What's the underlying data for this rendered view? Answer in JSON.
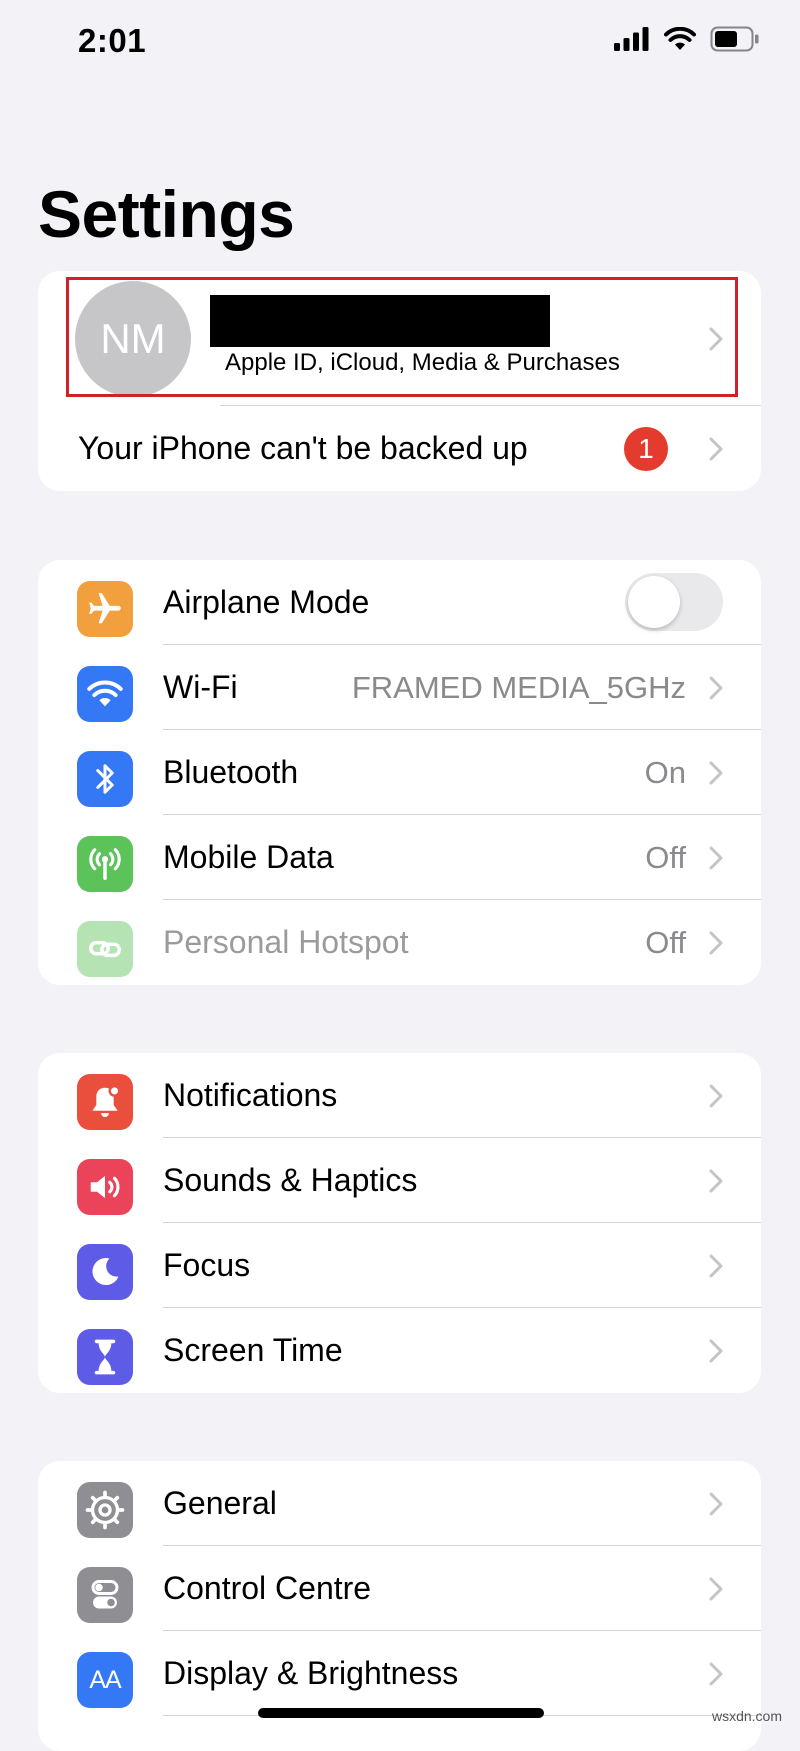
{
  "status_bar": {
    "time": "2:01"
  },
  "page": {
    "title": "Settings"
  },
  "account": {
    "avatar_initials": "NM",
    "subtitle": "Apple ID, iCloud, Media & Purchases",
    "backup_warning": "Your iPhone can't be backed up",
    "badge_count": "1"
  },
  "connectivity": [
    {
      "label": "Airplane Mode",
      "icon": "airplane-icon",
      "color": "#f2a03d",
      "toggle_on": false
    },
    {
      "label": "Wi-Fi",
      "value": "FRAMED MEDIA_5GHz",
      "icon": "wifi-icon",
      "color": "#3478f6"
    },
    {
      "label": "Bluetooth",
      "value": "On",
      "icon": "bluetooth-icon",
      "color": "#3478f6"
    },
    {
      "label": "Mobile Data",
      "value": "Off",
      "icon": "antenna-icon",
      "color": "#5cc25a"
    },
    {
      "label": "Personal Hotspot",
      "value": "Off",
      "icon": "hotspot-icon",
      "color": "#5cc25a",
      "disabled": true
    }
  ],
  "alerts": [
    {
      "label": "Notifications",
      "icon": "bell-icon",
      "color": "#ea4e3d"
    },
    {
      "label": "Sounds & Haptics",
      "icon": "speaker-icon",
      "color": "#eb445a"
    },
    {
      "label": "Focus",
      "icon": "moon-icon",
      "color": "#5e5ce6"
    },
    {
      "label": "Screen Time",
      "icon": "hourglass-icon",
      "color": "#5e5ce6"
    }
  ],
  "system": [
    {
      "label": "General",
      "icon": "gear-icon",
      "color": "#8e8e93"
    },
    {
      "label": "Control Centre",
      "icon": "toggles-icon",
      "color": "#8e8e93"
    },
    {
      "label": "Display & Brightness",
      "icon": "text-size-icon",
      "color": "#3478f6",
      "glyph": "AA"
    }
  ],
  "watermark": "wsxdn.com"
}
